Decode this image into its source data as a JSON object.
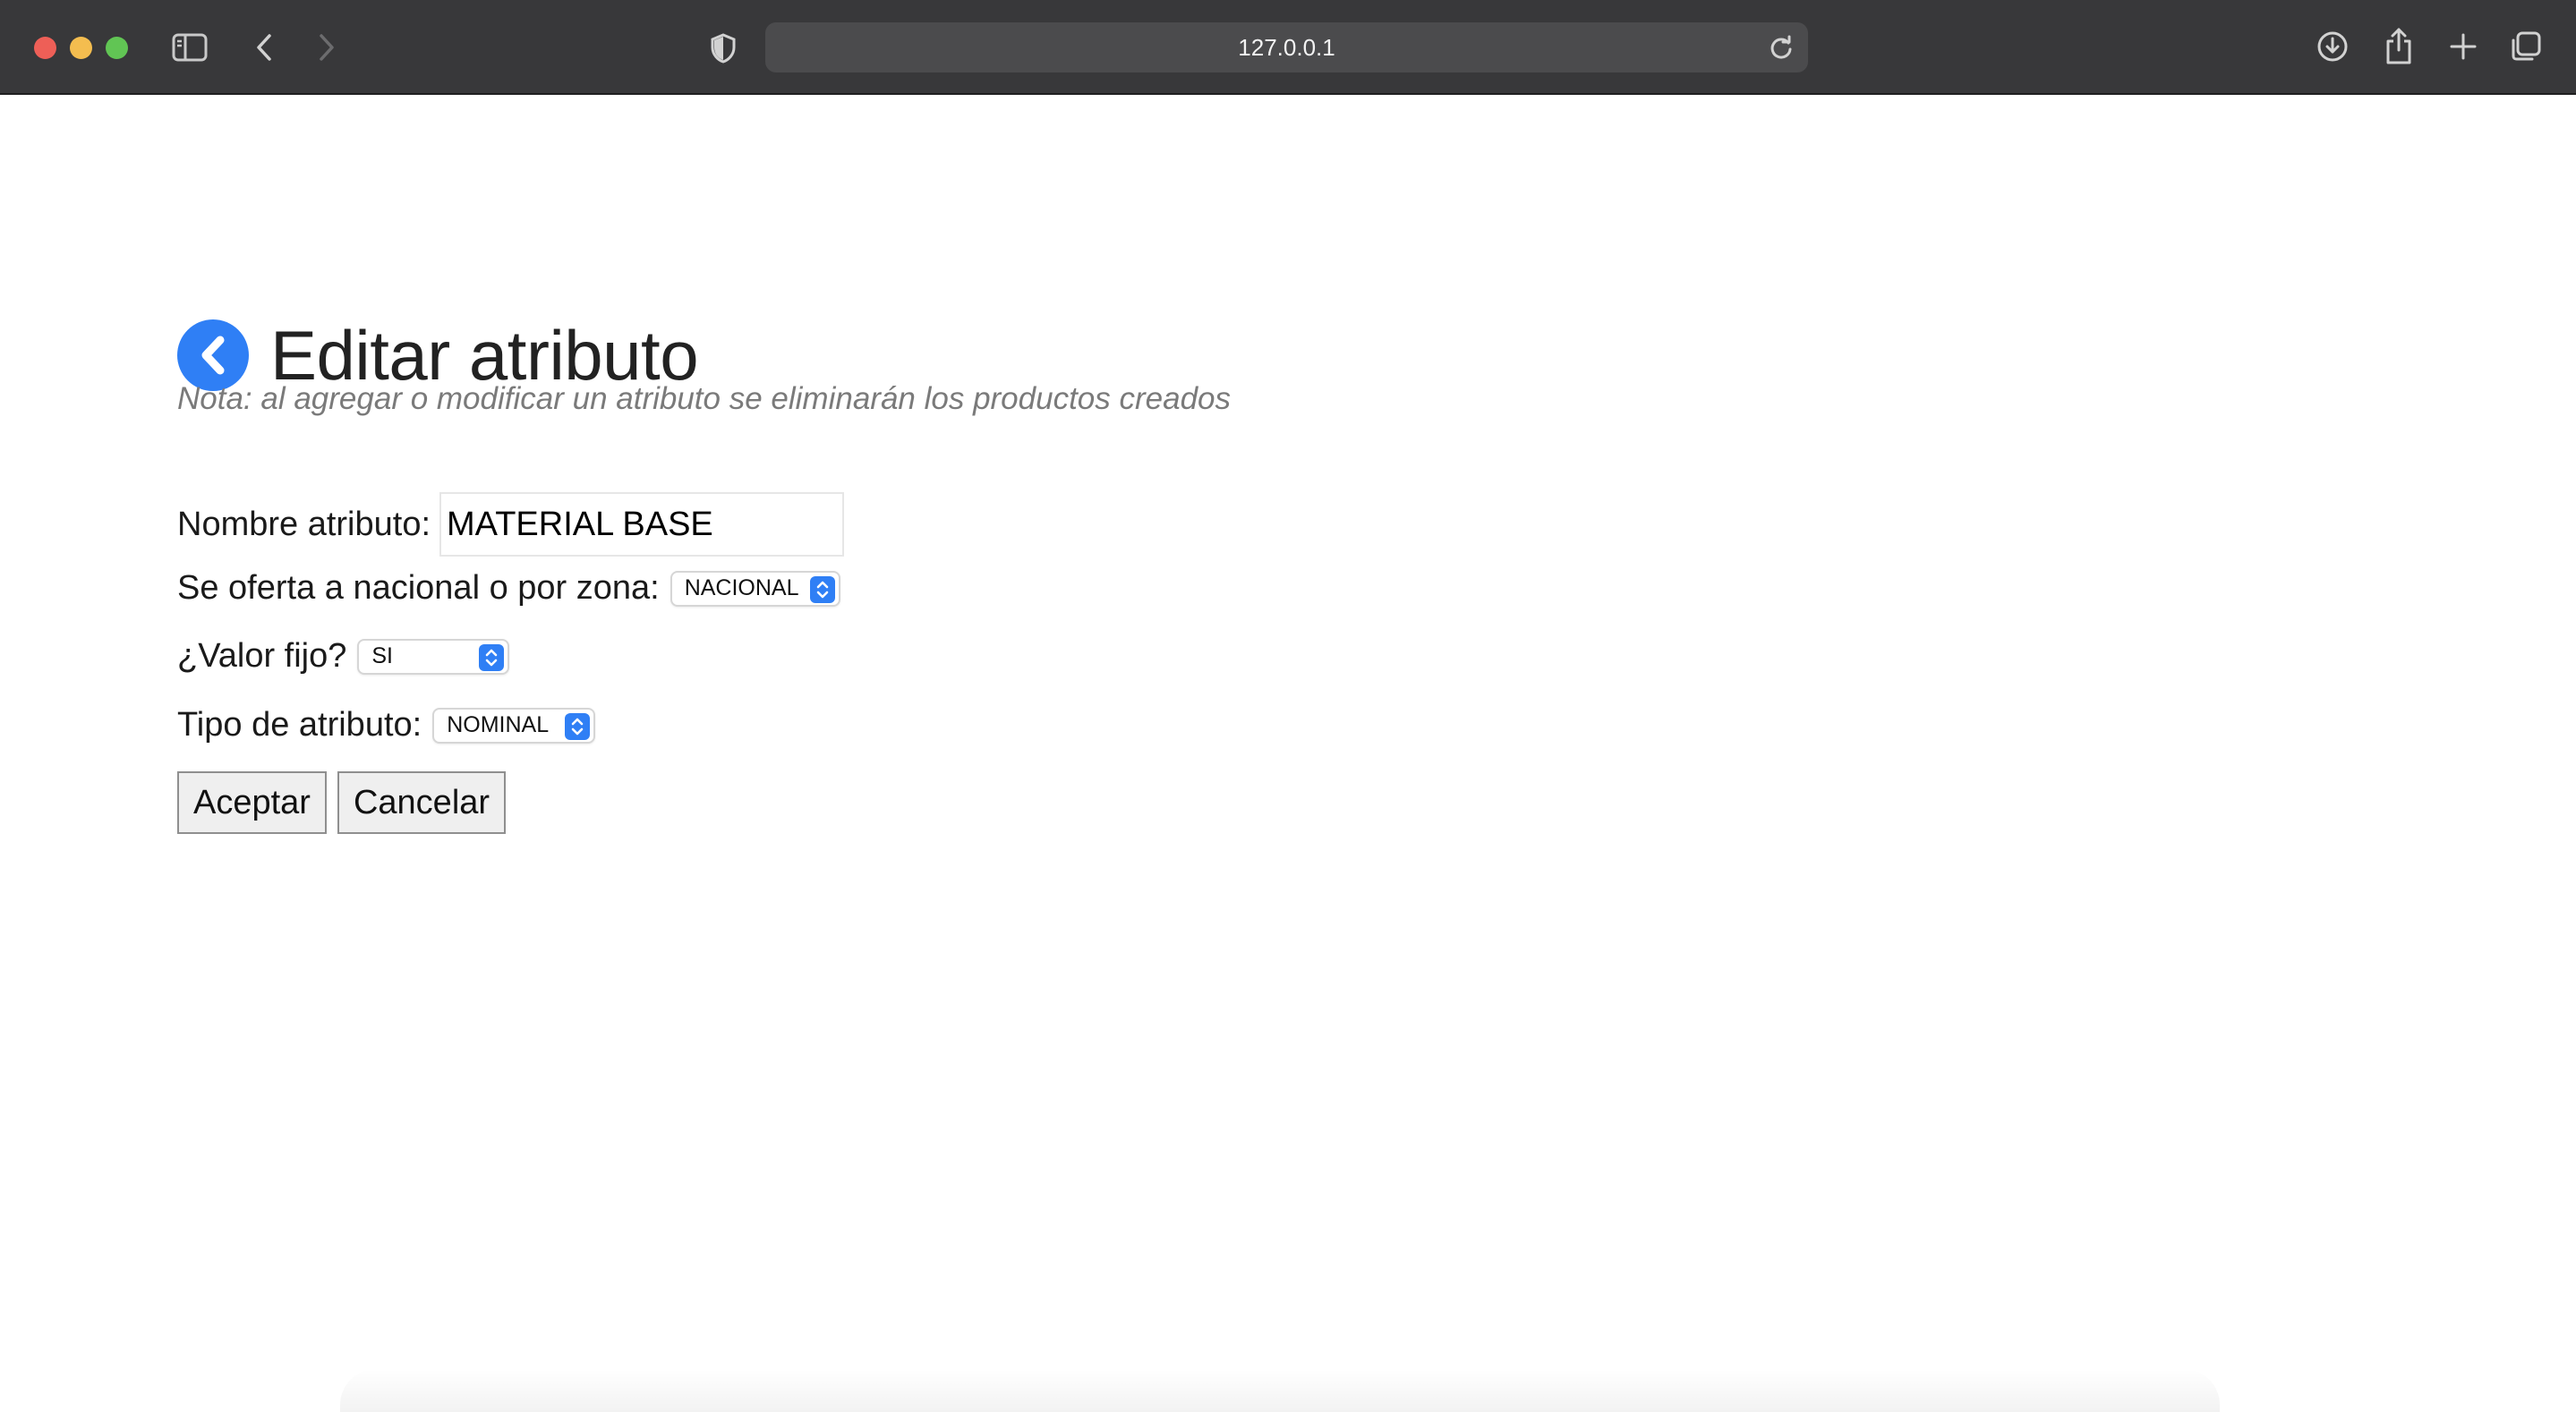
{
  "browser": {
    "url": "127.0.0.1"
  },
  "page": {
    "title": "Editar atributo",
    "note": "Nota: al agregar o modificar un atributo se eliminarán los productos creados"
  },
  "form": {
    "nombre_label": "Nombre atributo:",
    "nombre_value": "MATERIAL BASE",
    "oferta_label": "Se oferta a nacional o por zona:",
    "oferta_selected": "NACIONAL",
    "valor_fijo_label": "¿Valor fijo?",
    "valor_fijo_selected": "SI",
    "tipo_label": "Tipo de atributo:",
    "tipo_selected": "NOMINAL"
  },
  "buttons": {
    "accept": "Aceptar",
    "cancel": "Cancelar"
  },
  "colors": {
    "accent": "#2f7ff5",
    "chrome_bg": "#38383a"
  },
  "icons": {
    "sidebar": "sidebar-icon",
    "back": "chevron-left-icon",
    "forward": "chevron-right-icon",
    "privacy": "shield-icon",
    "reload": "reload-icon",
    "download": "download-icon",
    "share": "share-icon",
    "new_tab": "plus-icon",
    "tabs": "tabs-overview-icon",
    "page_back": "back-circle-icon"
  }
}
